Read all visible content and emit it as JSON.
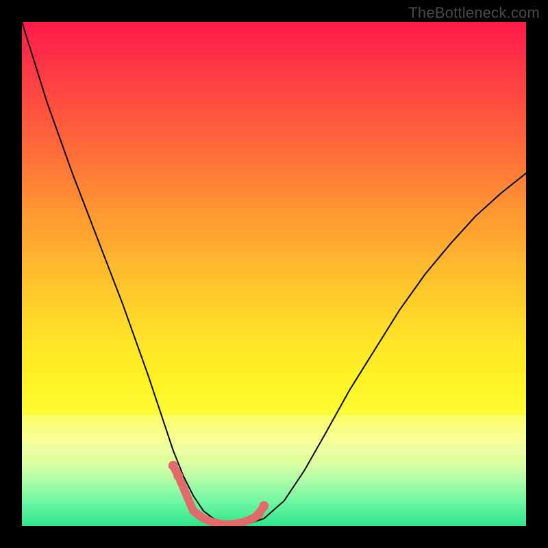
{
  "watermark": "TheBottleneck.com",
  "colors": {
    "frame": "#000000",
    "marker": "#e36a6a",
    "curve": "#000000",
    "gradient_top": "#ff1a4b",
    "gradient_bottom": "#2de58a"
  },
  "chart_data": {
    "type": "line",
    "title": "",
    "xlabel": "",
    "ylabel": "",
    "xlim": [
      0,
      100
    ],
    "ylim": [
      0,
      100
    ],
    "x": [
      0,
      5,
      10,
      15,
      20,
      25,
      28,
      30,
      32,
      34,
      36,
      38,
      40,
      42,
      45,
      48,
      52,
      56,
      60,
      65,
      70,
      75,
      80,
      85,
      90,
      95,
      100
    ],
    "y": [
      100,
      84,
      70,
      57,
      44,
      30,
      21,
      15,
      10,
      6,
      3,
      1.5,
      0.7,
      0.3,
      0.5,
      1.5,
      5,
      11,
      18,
      27,
      35,
      43,
      50,
      56,
      61.5,
      66,
      70
    ],
    "markers": {
      "x": [
        30,
        31,
        34,
        36,
        38,
        40,
        42,
        44,
        46,
        47,
        48
      ],
      "y": [
        12,
        10,
        3,
        1.5,
        0.7,
        0.3,
        0.4,
        0.8,
        1.6,
        2.4,
        4
      ]
    },
    "legend": [],
    "grid": false
  }
}
